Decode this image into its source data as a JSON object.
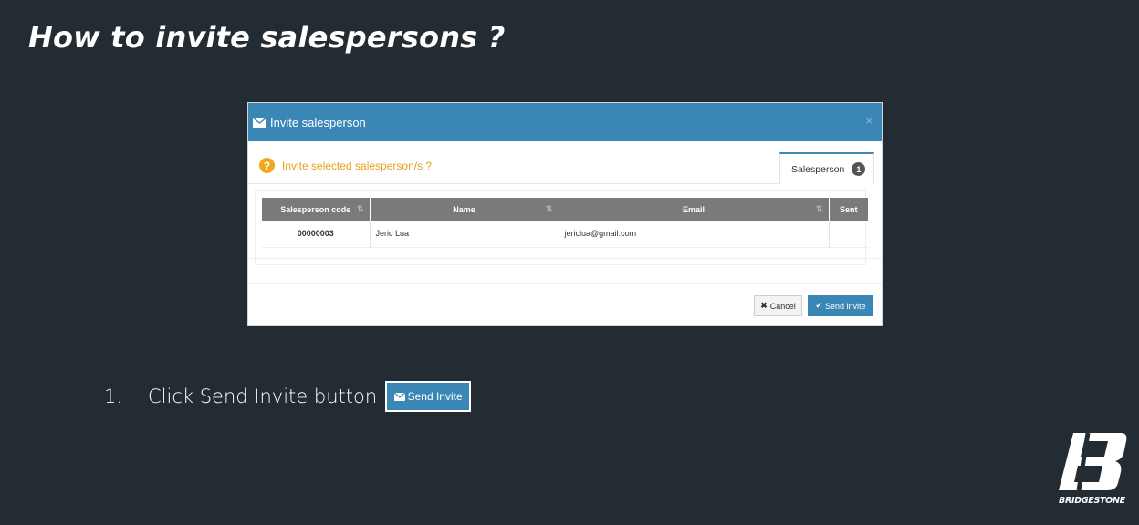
{
  "slide": {
    "title": "How to invite salespersons ?"
  },
  "modal": {
    "title": "Invite salesperson",
    "close": "×",
    "question": "Invite selected salesperson/s ?",
    "tab": {
      "label": "Salesperson",
      "count": "1"
    },
    "table": {
      "columns": [
        "Salesperson code",
        "Name",
        "Email",
        "Sent"
      ],
      "rows": [
        {
          "code": "00000003",
          "name": "Jeric Lua",
          "email": "jericlua@gmail.com",
          "sent": ""
        }
      ]
    },
    "buttons": {
      "cancel": "Cancel",
      "send": "Send invite"
    }
  },
  "steps": [
    {
      "number": "1.",
      "text": "Click Send Invite button",
      "button_label": "Send Invite"
    }
  ],
  "brand": {
    "name": "BRIDGESTONE"
  },
  "colors": {
    "background": "#242c33",
    "accent": "#3a87b6",
    "warning": "#f0a81e"
  },
  "icons": {
    "envelope": "envelope-icon",
    "question": "question-circle-icon",
    "check": "check-icon",
    "times": "times-icon"
  }
}
